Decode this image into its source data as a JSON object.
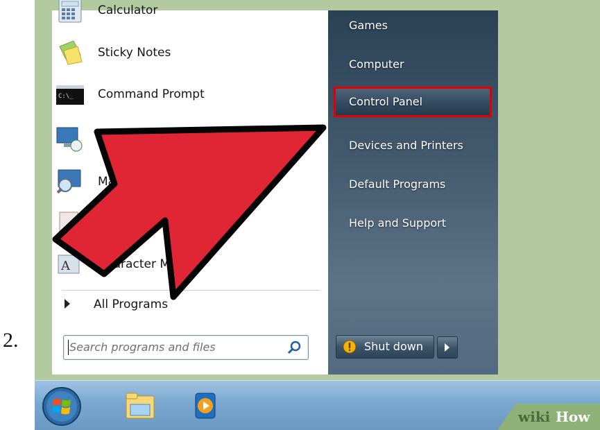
{
  "step_number": "2.",
  "start_menu": {
    "programs": [
      {
        "label": "Calculator",
        "icon": "calculator-icon"
      },
      {
        "label": "Sticky Notes",
        "icon": "sticky-notes-icon"
      },
      {
        "label": "Command Prompt",
        "icon": "command-prompt-icon"
      },
      {
        "label": "",
        "icon": "remote-desktop-icon"
      },
      {
        "label": "Magnifier",
        "icon": "magnifier-icon"
      },
      {
        "label": "",
        "icon": "program-icon"
      },
      {
        "label": "Character Map",
        "icon": "character-map-icon"
      }
    ],
    "all_programs_label": "All Programs",
    "search_placeholder": "Search programs and files",
    "places": [
      {
        "label": "Games",
        "selected": false
      },
      {
        "label": "Computer",
        "selected": false
      },
      {
        "label": "Control Panel",
        "selected": true
      },
      {
        "label": "Devices and Printers",
        "selected": false
      },
      {
        "label": "Default Programs",
        "selected": false
      },
      {
        "label": "Help and Support",
        "selected": false
      }
    ],
    "shutdown_label": "Shut down"
  },
  "taskbar": {
    "items": [
      "start-orb-icon",
      "windows-explorer-icon",
      "media-player-icon"
    ]
  },
  "watermark": {
    "part1": "wiki",
    "part2": "How"
  },
  "colors": {
    "highlight_border": "#e30000",
    "arrow_fill": "#e02634",
    "desktop": "#b3caa0",
    "places_panel": "#42596e"
  }
}
